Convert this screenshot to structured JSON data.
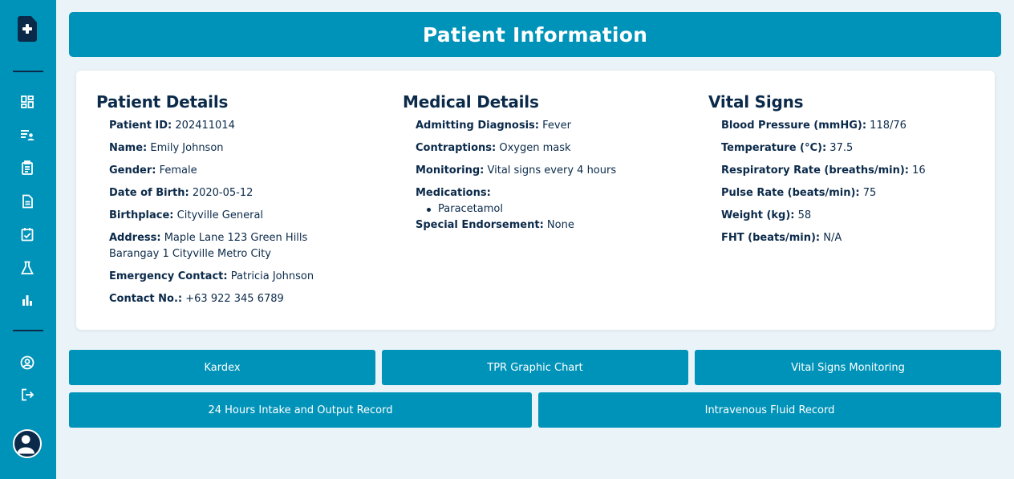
{
  "header": {
    "title": "Patient Information"
  },
  "sidebar": {
    "icons": [
      "dashboard-icon",
      "patient-list-icon",
      "clipboard-icon",
      "document-icon",
      "checklist-icon",
      "lab-flask-icon",
      "bar-chart-icon",
      "account-circle-icon",
      "logout-icon"
    ],
    "accent": "#0093b9",
    "dark": "#0b2a4a"
  },
  "patient_details": {
    "heading": "Patient Details",
    "fields": [
      {
        "label": "Patient ID:",
        "value": "202411014"
      },
      {
        "label": "Name:",
        "value": "Emily Johnson"
      },
      {
        "label": "Gender:",
        "value": "Female"
      },
      {
        "label": "Date of Birth:",
        "value": "2020-05-12"
      },
      {
        "label": "Birthplace:",
        "value": "Cityville General"
      },
      {
        "label": "Address:",
        "value": "Maple Lane 123 Green Hills",
        "value2": "Barangay 1 Cityville Metro City"
      },
      {
        "label": "Emergency Contact:",
        "value": "Patricia Johnson"
      },
      {
        "label": "Contact No.:",
        "value": "+63 922 345 6789"
      }
    ]
  },
  "medical_details": {
    "heading": "Medical Details",
    "fields": [
      {
        "label": "Admitting Diagnosis:",
        "value": "Fever"
      },
      {
        "label": "Contraptions:",
        "value": "Oxygen mask"
      },
      {
        "label": "Monitoring:",
        "value": "Vital signs every 4 hours"
      },
      {
        "label": "Medications:",
        "value": ""
      },
      {
        "label": "Special Endorsement:",
        "value": "None"
      }
    ],
    "medications": [
      "Paracetamol"
    ]
  },
  "vital_signs": {
    "heading": "Vital Signs",
    "fields": [
      {
        "label": "Blood Pressure (mmHG):",
        "value": "118/76"
      },
      {
        "label": "Temperature (°C):",
        "value": "37.5"
      },
      {
        "label": "Respiratory Rate (breaths/min):",
        "value": "16"
      },
      {
        "label": "Pulse Rate (beats/min):",
        "value": "75"
      },
      {
        "label": "Weight (kg):",
        "value": "58"
      },
      {
        "label": "FHT (beats/min):",
        "value": "N/A"
      }
    ]
  },
  "actions": {
    "kardex": "Kardex",
    "tpr": "TPR Graphic Chart",
    "vital_monitoring": "Vital Signs Monitoring",
    "intake_output": "24 Hours Intake and Output Record",
    "iv_fluid": "Intravenous Fluid Record"
  }
}
